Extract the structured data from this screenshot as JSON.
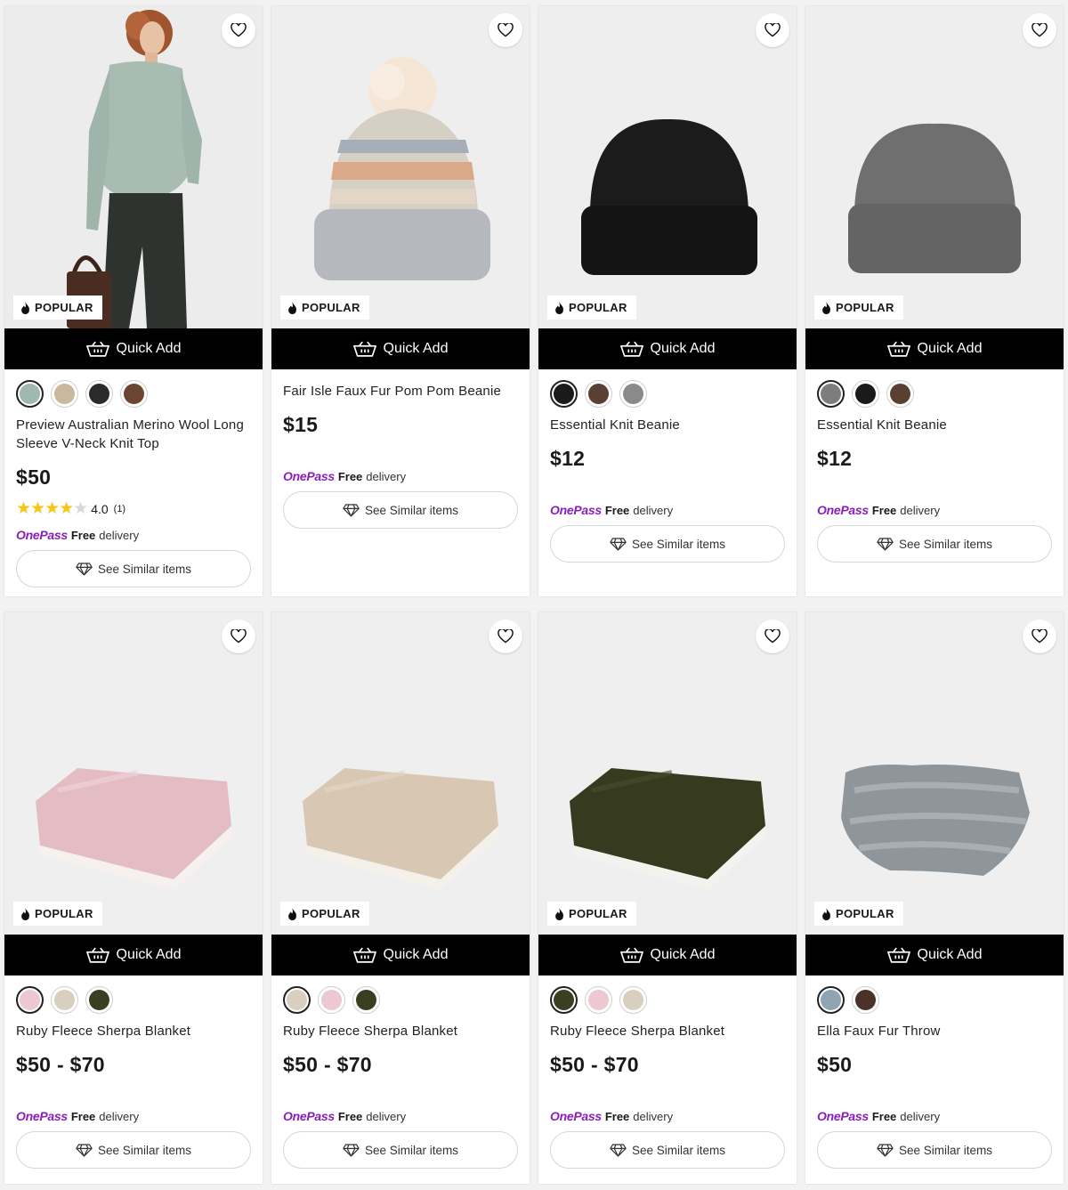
{
  "labels": {
    "badge": "POPULAR",
    "quick_add": "Quick Add",
    "see_similar": "See Similar items",
    "onepass": "OnePass",
    "free": "Free",
    "delivery": "delivery"
  },
  "colors": {
    "onepass_purple": "#8a1fb8",
    "quick_add_bg": "#000000",
    "star": "#f5c518"
  },
  "products": [
    {
      "title": "Preview Australian Merino Wool Long Sleeve V-Neck Knit Top",
      "price": "$50",
      "rating": "4.0",
      "rating_count": "(1)",
      "stars": 4,
      "image": "woman-in-sage-knit-top",
      "swatches": [
        "#9fb8b0",
        "#c9b89c",
        "#2a2a2a",
        "#6b4530"
      ]
    },
    {
      "title": "Fair Isle Faux Fur Pom Pom Beanie",
      "price": "$15",
      "image": "fair-isle-pom-beanie",
      "swatches": []
    },
    {
      "title": "Essential Knit Beanie",
      "price": "$12",
      "image": "black-knit-beanie",
      "swatches": [
        "#1a1a1a",
        "#5a4032",
        "#8a8a8a"
      ]
    },
    {
      "title": "Essential Knit Beanie",
      "price": "$12",
      "image": "grey-knit-beanie",
      "swatches": [
        "#7d7d7d",
        "#1a1a1a",
        "#5a4032"
      ]
    },
    {
      "title": "Ruby Fleece Sherpa Blanket",
      "price": "$50 - $70",
      "image": "pink-sherpa-blanket",
      "swatches": [
        "#ecc9d0",
        "#d9cfbf",
        "#3b3f22"
      ]
    },
    {
      "title": "Ruby Fleece Sherpa Blanket",
      "price": "$50 - $70",
      "image": "beige-sherpa-blanket",
      "swatches": [
        "#d9cfbf",
        "#ecc9d0",
        "#3b3f22"
      ]
    },
    {
      "title": "Ruby Fleece Sherpa Blanket",
      "price": "$50 - $70",
      "image": "olive-sherpa-blanket",
      "swatches": [
        "#3b3f22",
        "#ecc9d0",
        "#d9cfbf"
      ]
    },
    {
      "title": "Ella Faux Fur Throw",
      "price": "$50",
      "image": "grey-faux-fur-throw",
      "swatches": [
        "#8fa6b2",
        "#4a3228"
      ]
    }
  ]
}
